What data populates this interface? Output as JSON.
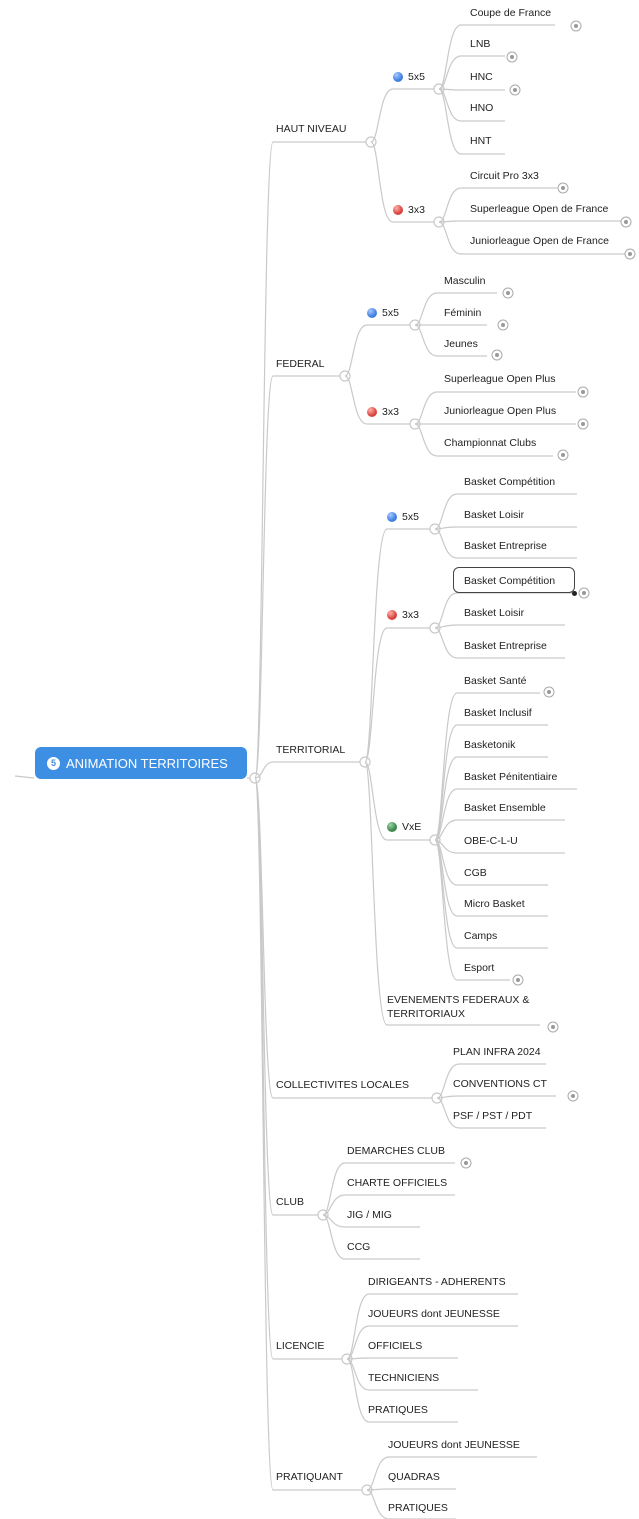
{
  "root": {
    "badge": "5",
    "label": "ANIMATION TERRITOIRES"
  },
  "colors": {
    "root": "#3d8fe3",
    "line": "#c9c9c9",
    "blue_ball": "#3f7fe0",
    "red_ball": "#d9433e",
    "green_ball": "#3b8a49"
  },
  "haut_niveau": {
    "label": "HAUT NIVEAU",
    "g5x5": {
      "label": "5x5",
      "items": [
        "Coupe de France",
        "LNB",
        "HNC",
        "HNO",
        "HNT"
      ]
    },
    "g3x3": {
      "label": "3x3",
      "items": [
        "Circuit Pro 3x3",
        "Superleague Open de France",
        "Juniorleague Open de France"
      ]
    }
  },
  "federal": {
    "label": "FEDERAL",
    "g5x5": {
      "label": "5x5",
      "items": [
        "Masculin",
        "Féminin",
        "Jeunes"
      ]
    },
    "g3x3": {
      "label": "3x3",
      "items": [
        "Superleague Open Plus",
        "Juniorleague Open Plus",
        "Championnat Clubs"
      ]
    }
  },
  "territorial": {
    "label": "TERRITORIAL",
    "g5x5": {
      "label": "5x5",
      "items": [
        "Basket Compétition",
        "Basket Loisir",
        "Basket Entreprise"
      ]
    },
    "g3x3": {
      "label": "3x3",
      "items": [
        "Basket Compétition",
        "Basket Loisir",
        "Basket Entreprise"
      ]
    },
    "vxe": {
      "label": "VxE",
      "items": [
        "Basket Santé",
        "Basket Inclusif",
        "Basketonik",
        "Basket Pénitentiaire",
        "Basket Ensemble",
        "OBE-C-L-U",
        "CGB",
        "Micro Basket",
        "Camps",
        "Esport"
      ]
    },
    "events": {
      "line1": "EVENEMENTS FEDERAUX &",
      "line2": "TERRITORIAUX"
    }
  },
  "collectivites": {
    "label": "COLLECTIVITES LOCALES",
    "items": [
      "PLAN INFRA 2024",
      "CONVENTIONS CT",
      "PSF / PST / PDT"
    ]
  },
  "club": {
    "label": "CLUB",
    "items": [
      "DEMARCHES CLUB",
      "CHARTE OFFICIELS",
      "JIG / MIG",
      "CCG"
    ]
  },
  "licencie": {
    "label": "LICENCIE",
    "items": [
      "DIRIGEANTS - ADHERENTS",
      "JOUEURS dont JEUNESSE",
      "OFFICIELS",
      "TECHNICIENS",
      "PRATIQUES"
    ]
  },
  "pratiquant": {
    "label": "PRATIQUANT",
    "items": [
      "JOUEURS dont JEUNESSE",
      "QUADRAS",
      "PRATIQUES"
    ]
  }
}
